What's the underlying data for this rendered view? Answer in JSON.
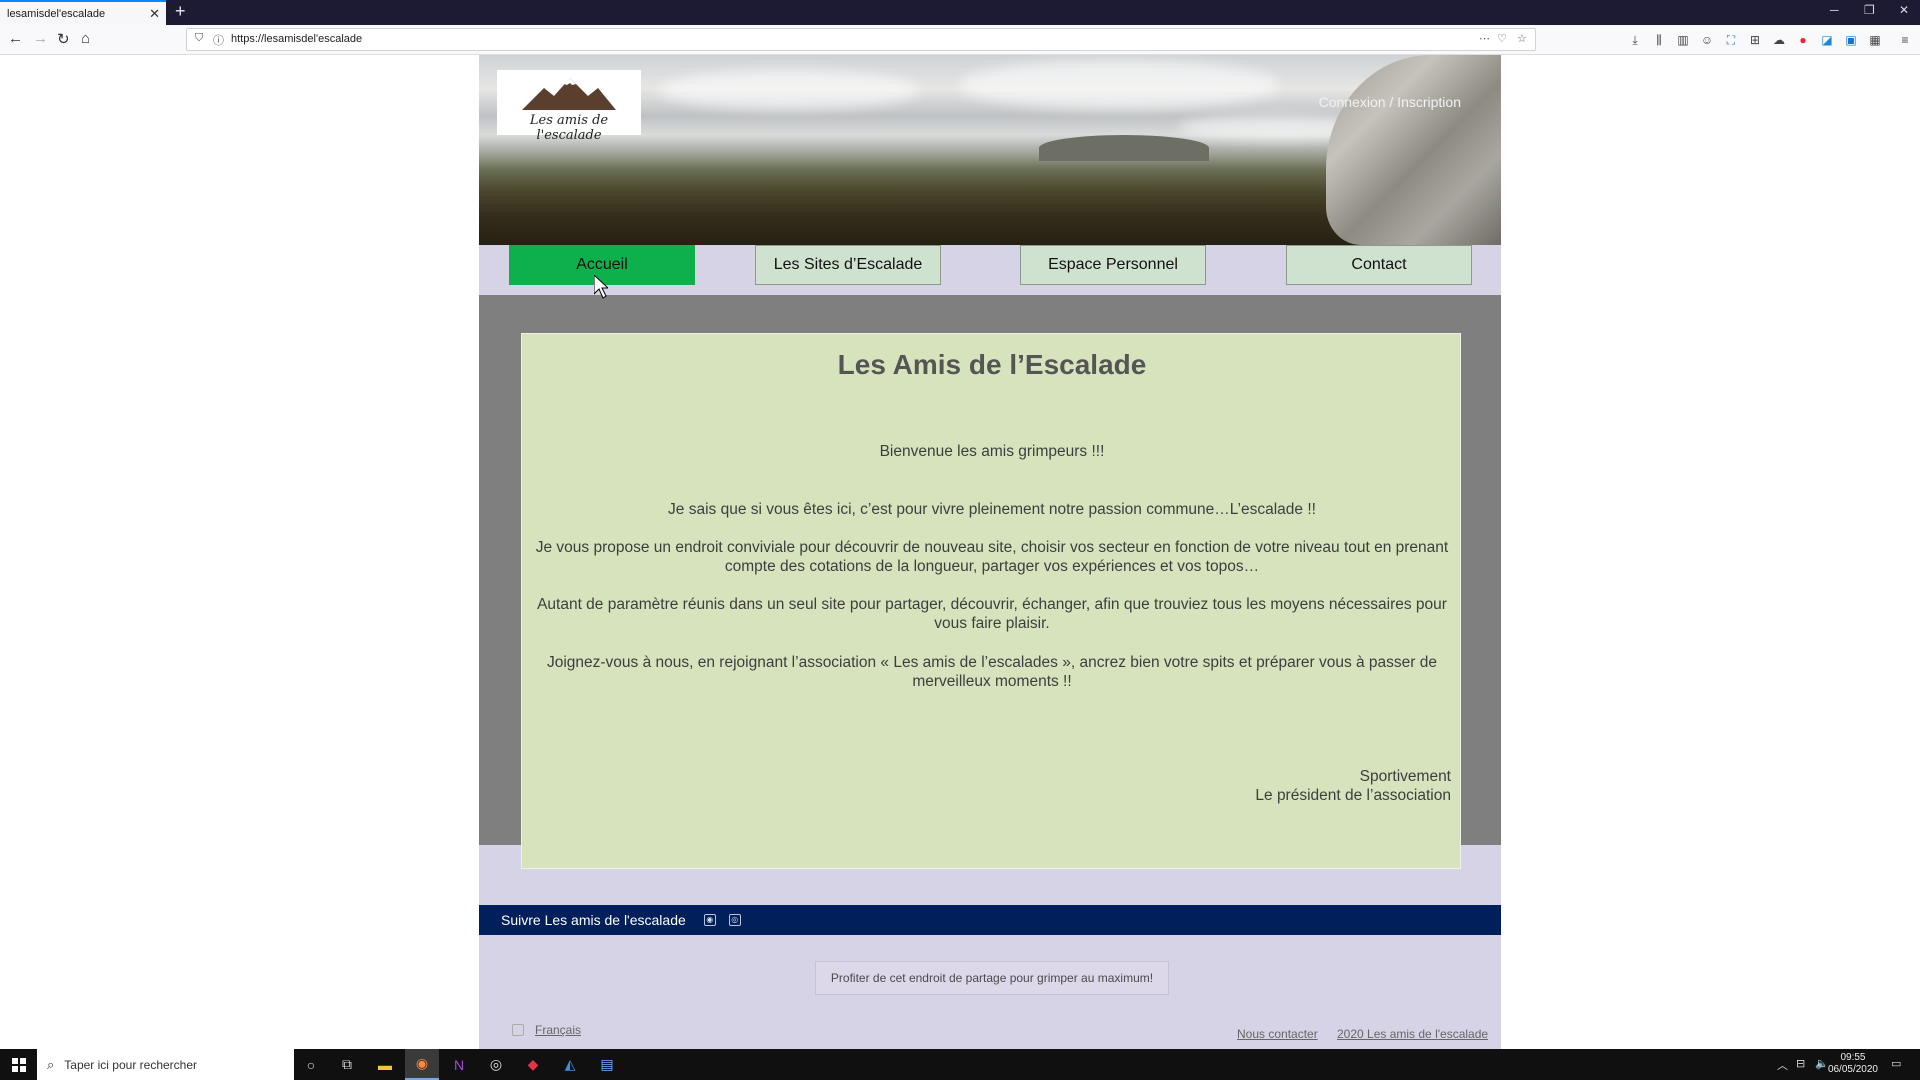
{
  "browser": {
    "tab_title": "lesamisdel'escalade",
    "tab_close": "✕",
    "new_tab": "+",
    "url": "https://lesamisdel'escalade"
  },
  "header": {
    "logo_text": "Les amis de l'escalade",
    "auth_link": "Connexion / Inscription"
  },
  "menu": {
    "items": [
      {
        "label": "Accueil"
      },
      {
        "label": "Les Sites d’Escalade"
      },
      {
        "label": "Espace Personnel"
      },
      {
        "label": "Contact"
      }
    ]
  },
  "main": {
    "title": "Les Amis de l’Escalade",
    "welcome": "Bienvenue les amis grimpeurs !!!",
    "p1": "Je sais que si vous êtes ici, c’est pour vivre pleinement notre passion commune…L’escalade !!",
    "p2": "Je vous propose un endroit conviviale pour découvrir de nouveau site, choisir vos secteur en fonction de votre niveau tout en prenant compte des cotations de la longueur, partager vos expériences et vos topos…",
    "p3": "Autant de paramètre réunis dans un seul site pour partager, découvrir, échanger, afin que trouviez tous les moyens nécessaires pour vous faire plaisir.",
    "p4": "Joignez-vous à nous, en rejoignant l’association « Les amis de l’escalades », ancrez bien votre spits et  préparer vous à passer de merveilleux moments !!",
    "sign_line1": "Sportivement",
    "sign_line2": "Le président de l’association"
  },
  "follow": {
    "label": "Suivre Les amis de l'escalade"
  },
  "footer": {
    "note": "Profiter de cet endroit de partage pour grimper au maximum!",
    "language": "Français",
    "contact_link": "Nous contacter",
    "copyright_link": "2020 Les amis de l'escalade"
  },
  "taskbar": {
    "search_placeholder": "Taper ici pour rechercher",
    "time": "09:55",
    "date": "06/05/2020"
  },
  "colors": {
    "menu_active": "#0db04b",
    "menu_inactive": "#cfe2cf",
    "card_bg": "#d6e3bd",
    "follow_bar": "#001f5b",
    "page_bg": "#d7d3e6"
  }
}
